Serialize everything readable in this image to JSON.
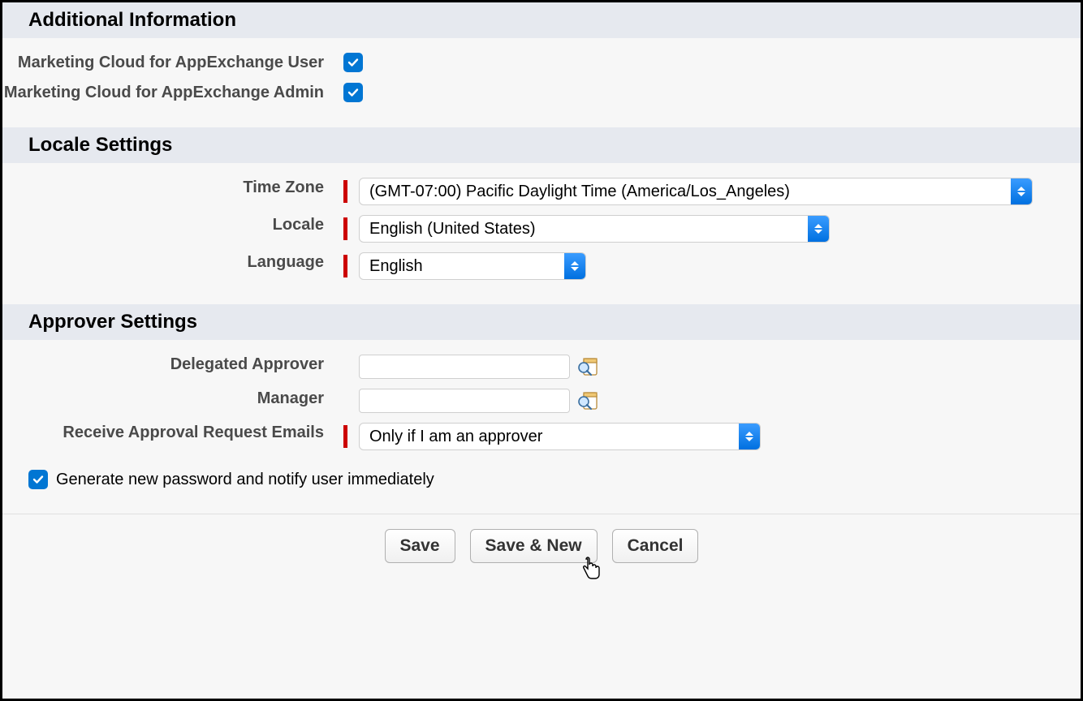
{
  "sections": {
    "additional": {
      "title": "Additional Information",
      "mc_user_label": "Marketing Cloud for AppExchange User",
      "mc_admin_label": "Marketing Cloud for AppExchange Admin"
    },
    "locale": {
      "title": "Locale Settings",
      "timezone_label": "Time Zone",
      "timezone_value": "(GMT-07:00) Pacific Daylight Time (America/Los_Angeles)",
      "locale_label": "Locale",
      "locale_value": "English (United States)",
      "language_label": "Language",
      "language_value": "English"
    },
    "approver": {
      "title": "Approver Settings",
      "delegated_label": "Delegated Approver",
      "delegated_value": "",
      "manager_label": "Manager",
      "manager_value": "",
      "receive_label": "Receive Approval Request Emails",
      "receive_value": "Only if I am an approver"
    }
  },
  "generate_pw_label": "Generate new password and notify user immediately",
  "buttons": {
    "save": "Save",
    "save_new": "Save & New",
    "cancel": "Cancel"
  },
  "checkboxes": {
    "mc_user": true,
    "mc_admin": true,
    "generate_pw": true
  }
}
